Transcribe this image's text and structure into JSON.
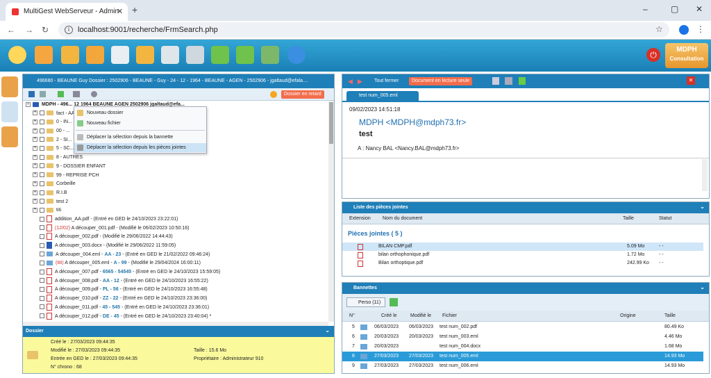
{
  "browser": {
    "tab_title": "MultiGest WebServeur - Admin",
    "url": "localhost:9001/recherche/FrmSearch.php"
  },
  "badge": {
    "title": "MDPH",
    "subtitle": "Consultation"
  },
  "left": {
    "header": "496680 - BEAUNE Guy Dossier : 2502906 - BEAUNE - Guy - 24 - 12 - 1964 - BEAUNE - AGEN - 2502906 - jgaltaud@efala....",
    "retard_label": "Dossier en retard",
    "tree_root": "MDPH - 496... 12 1964 BEAUNE AGEN 2502906 jgaltaud@efa...",
    "tree": [
      {
        "t": "fact - AA..."
      },
      {
        "t": "0 - IN..."
      },
      {
        "t": "00 - ..."
      },
      {
        "t": "2 - SI..."
      },
      {
        "t": "5 - SC..."
      },
      {
        "t": "8 - AUTRES"
      },
      {
        "t": "9 - DOSSIER ENFANT"
      },
      {
        "t": "99 - REPRISE PCH"
      },
      {
        "t": "Corbeille"
      },
      {
        "t": "R.I.B"
      },
      {
        "t": "test 2"
      },
      {
        "t": "titi"
      }
    ],
    "files": [
      {
        "icon": "pdf",
        "a": "addition_AA.pdf - (Entré en GED le 24/10/2023 23:22:01)",
        "tag": ""
      },
      {
        "icon": "pdf",
        "a": "A découper_001.pdf - (Modifié le 06/02/2023 10:50:16)",
        "pre": "(12/02) "
      },
      {
        "icon": "pdf",
        "a": "A découper_002.pdf - (Modifié le 29/06/2022 14:44:43)"
      },
      {
        "icon": "doc",
        "a": "A découper_003.docx - (Modifié le 29/06/2022 11:59:05)"
      },
      {
        "icon": "eml",
        "a": "A découper_004.eml - ",
        "tag": "AA - 23",
        "b": " - (Entré en GED le 21/02/2022 09:46:24)"
      },
      {
        "icon": "eml",
        "pre": "(titi) ",
        "a": "A découper_005.eml - ",
        "tag": "A - 99",
        "b": " - (Modifié le 29/04/2024 16:00:11)"
      },
      {
        "icon": "pdf",
        "a": "A découper_007.pdf - ",
        "tag": "6565 - 54545",
        "b": " - (Entré en GED le 24/10/2023 15:59:05)"
      },
      {
        "icon": "pdf",
        "a": "A découper_008.pdf - ",
        "tag": "AA - 12",
        "b": " - (Entré en GED le 24/10/2023 16:55:22)"
      },
      {
        "icon": "pdf",
        "a": "A découper_009.pdf - ",
        "tag": "PL - 56",
        "b": " - (Entré en GED le 24/10/2023 16:55:48)"
      },
      {
        "icon": "pdf",
        "a": "A découper_010.pdf - ",
        "tag": "ZZ - 22",
        "b": " - (Entré en GED le 24/10/2023 23:36:00)"
      },
      {
        "icon": "pdf",
        "a": "A découper_011.pdf - ",
        "tag": "45 - 545",
        "b": " - (Entré en GED le 24/10/2023 23:36:01)"
      },
      {
        "icon": "pdf",
        "a": "A découper_012.pdf - ",
        "tag": "DE - 45",
        "b": " - (Entré en GED le 24/10/2023 23:40:04) *"
      }
    ],
    "menu": [
      "Nouveau dossier",
      "Nouveau fichier",
      "Déplacer la sélection depuis la bannette",
      "Déplacer la sélection depuis les pièces jointes"
    ]
  },
  "dossier": {
    "title": "Dossier",
    "cree": "Créé le :  27/03/2023 09:44:35",
    "modifie": "Modifié le :  27/03/2023 09:44:35",
    "ged": "Entrée en GED le :  27/03/2023 09:44:35",
    "chrono": "N° chrono :  68",
    "taille": "Taille :  15.6 Mo",
    "proprio": "Propriétaire :  Administrateur 910"
  },
  "right": {
    "tout_fermer": "Tout fermer",
    "lecture": "Document en lecture seule",
    "tab": "test num_005.eml",
    "date": "09/02/2023 14:51:18",
    "from": "MDPH <MDPH@mdph73.fr>",
    "subject": "test",
    "to": "A : Nancy BAL <Nancy.BAL@mdph73.fr>"
  },
  "attachments": {
    "title": "Liste des pièces jointes",
    "cols": [
      "Extension",
      "Nom du document",
      "Taille",
      "Statut"
    ],
    "group": "Pièces jointes ( 5 )",
    "rows": [
      {
        "name": "BILAN CMP.pdf",
        "size": "5.09 Mo",
        "status": "- -"
      },
      {
        "name": "bilan orthophonique.pdf",
        "size": "1.72 Mo",
        "status": "- -"
      },
      {
        "name": "Bilan orthoptique.pdf",
        "size": "242.99 Ko",
        "status": "- -"
      }
    ]
  },
  "bannettes": {
    "title": "Bannettes",
    "perso": "Perso (11)",
    "cols": [
      "N°",
      "Créé le",
      "Modifié le",
      "Fichier",
      "Origine",
      "Taille"
    ],
    "rows": [
      {
        "n": "5",
        "c": "06/03/2023",
        "m": "06/03/2023",
        "f": "test num_002.pdf",
        "s": "80.49 Ko"
      },
      {
        "n": "6",
        "c": "20/03/2023",
        "m": "20/03/2023",
        "f": "test num_003.eml",
        "s": "4.46 Mo"
      },
      {
        "n": "7",
        "c": "20/03/2023",
        "m": "",
        "f": "test num_004.docx",
        "s": "1.68 Mo"
      },
      {
        "n": "8",
        "c": "27/03/2023",
        "m": "27/03/2023",
        "f": "test num_005.eml",
        "s": "14.93 Mo"
      },
      {
        "n": "9",
        "c": "27/03/2023",
        "m": "27/03/2023",
        "f": "test num_006.eml",
        "s": "14.93 Mo"
      }
    ]
  }
}
